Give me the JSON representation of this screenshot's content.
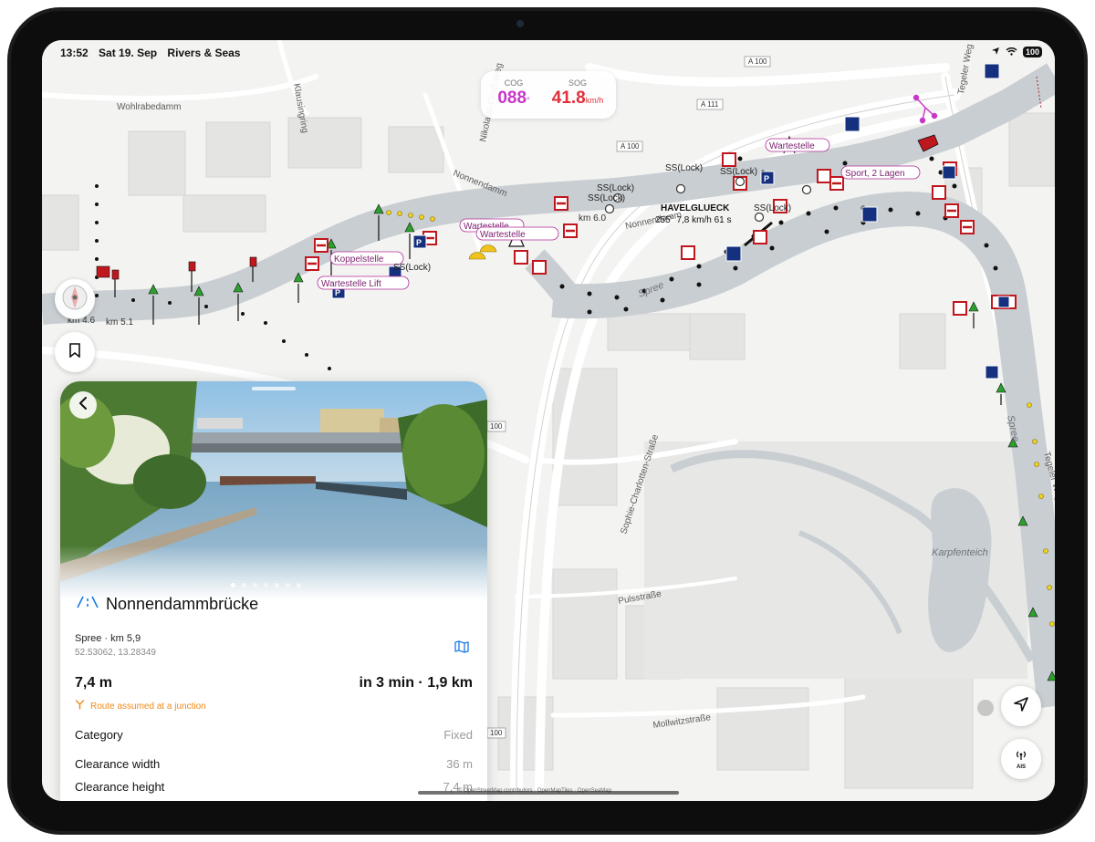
{
  "status": {
    "time": "13:52",
    "date": "Sat 19. Sep",
    "app": "Rivers & Seas",
    "battery": "100"
  },
  "instruments": {
    "cog_label": "COG",
    "cog_value": "088",
    "cog_unit": "°",
    "sog_label": "SOG",
    "sog_value": "41.8",
    "sog_unit": "km/h"
  },
  "map": {
    "streets": [
      "Wohlrabedamm",
      "Nonnendamm",
      "Nonnendamm",
      "Pulsstraße",
      "Mollwitzstraße",
      "Sophie-Charlotten-Straße",
      "Tegeler Weg",
      "Tegeler Weg",
      "Nikolaus-Groß-Weg",
      "Klausingring"
    ],
    "roads": [
      "A 100",
      "A 111",
      "A 100",
      "100",
      "100"
    ],
    "water_labels": [
      "Spree",
      "Spree",
      "Karpfenteich"
    ],
    "markers": [
      "Wartestelle",
      "Wartestelle",
      "Koppelstelle",
      "Wartestelle Lift",
      "Wartestelle",
      "Sport, 2 Lagen"
    ],
    "locks": [
      "SS(Lock)",
      "SS(Lock)",
      "SS(Lock)",
      "SS(Lock)",
      "SS(Lock)",
      "SS(Lock)"
    ],
    "km_labels": [
      "km 4.6",
      "km 5.1",
      "km 6.0"
    ],
    "vessel_name": "HAVELGLUECK",
    "vessel_info": "255° 7,8 km/h 61 s",
    "attribution": "© OpenStreetMap contributors · OpenMapTiles · OpenSeaMap"
  },
  "panel": {
    "title": "Nonnendammbrücke",
    "waterway": "Spree · km 5,9",
    "coordinates": "52.53062, 13.28349",
    "clearance": "7,4 m",
    "eta": "in 3 min · 1,9 km",
    "junction_note": "Route assumed at a junction",
    "properties": [
      {
        "label": "Category",
        "value": "Fixed"
      },
      {
        "label": "Clearance width",
        "value": "36 m"
      },
      {
        "label": "Clearance height",
        "value": "7,4 m"
      }
    ],
    "photo_count": 7
  },
  "buttons": {
    "ais_label": "AIS"
  },
  "colors": {
    "cog": "#c837c8",
    "sog": "#e0303c",
    "water": "#c9ced2",
    "accent": "#1a7ae8",
    "warning": "#ef8a1a"
  },
  "icons": [
    "compass-icon",
    "bookmark-icon",
    "back-icon",
    "bridge-icon",
    "map-icon",
    "junction-icon",
    "location-arrow-icon",
    "ais-antenna-icon",
    "wifi-icon",
    "location-icon"
  ]
}
